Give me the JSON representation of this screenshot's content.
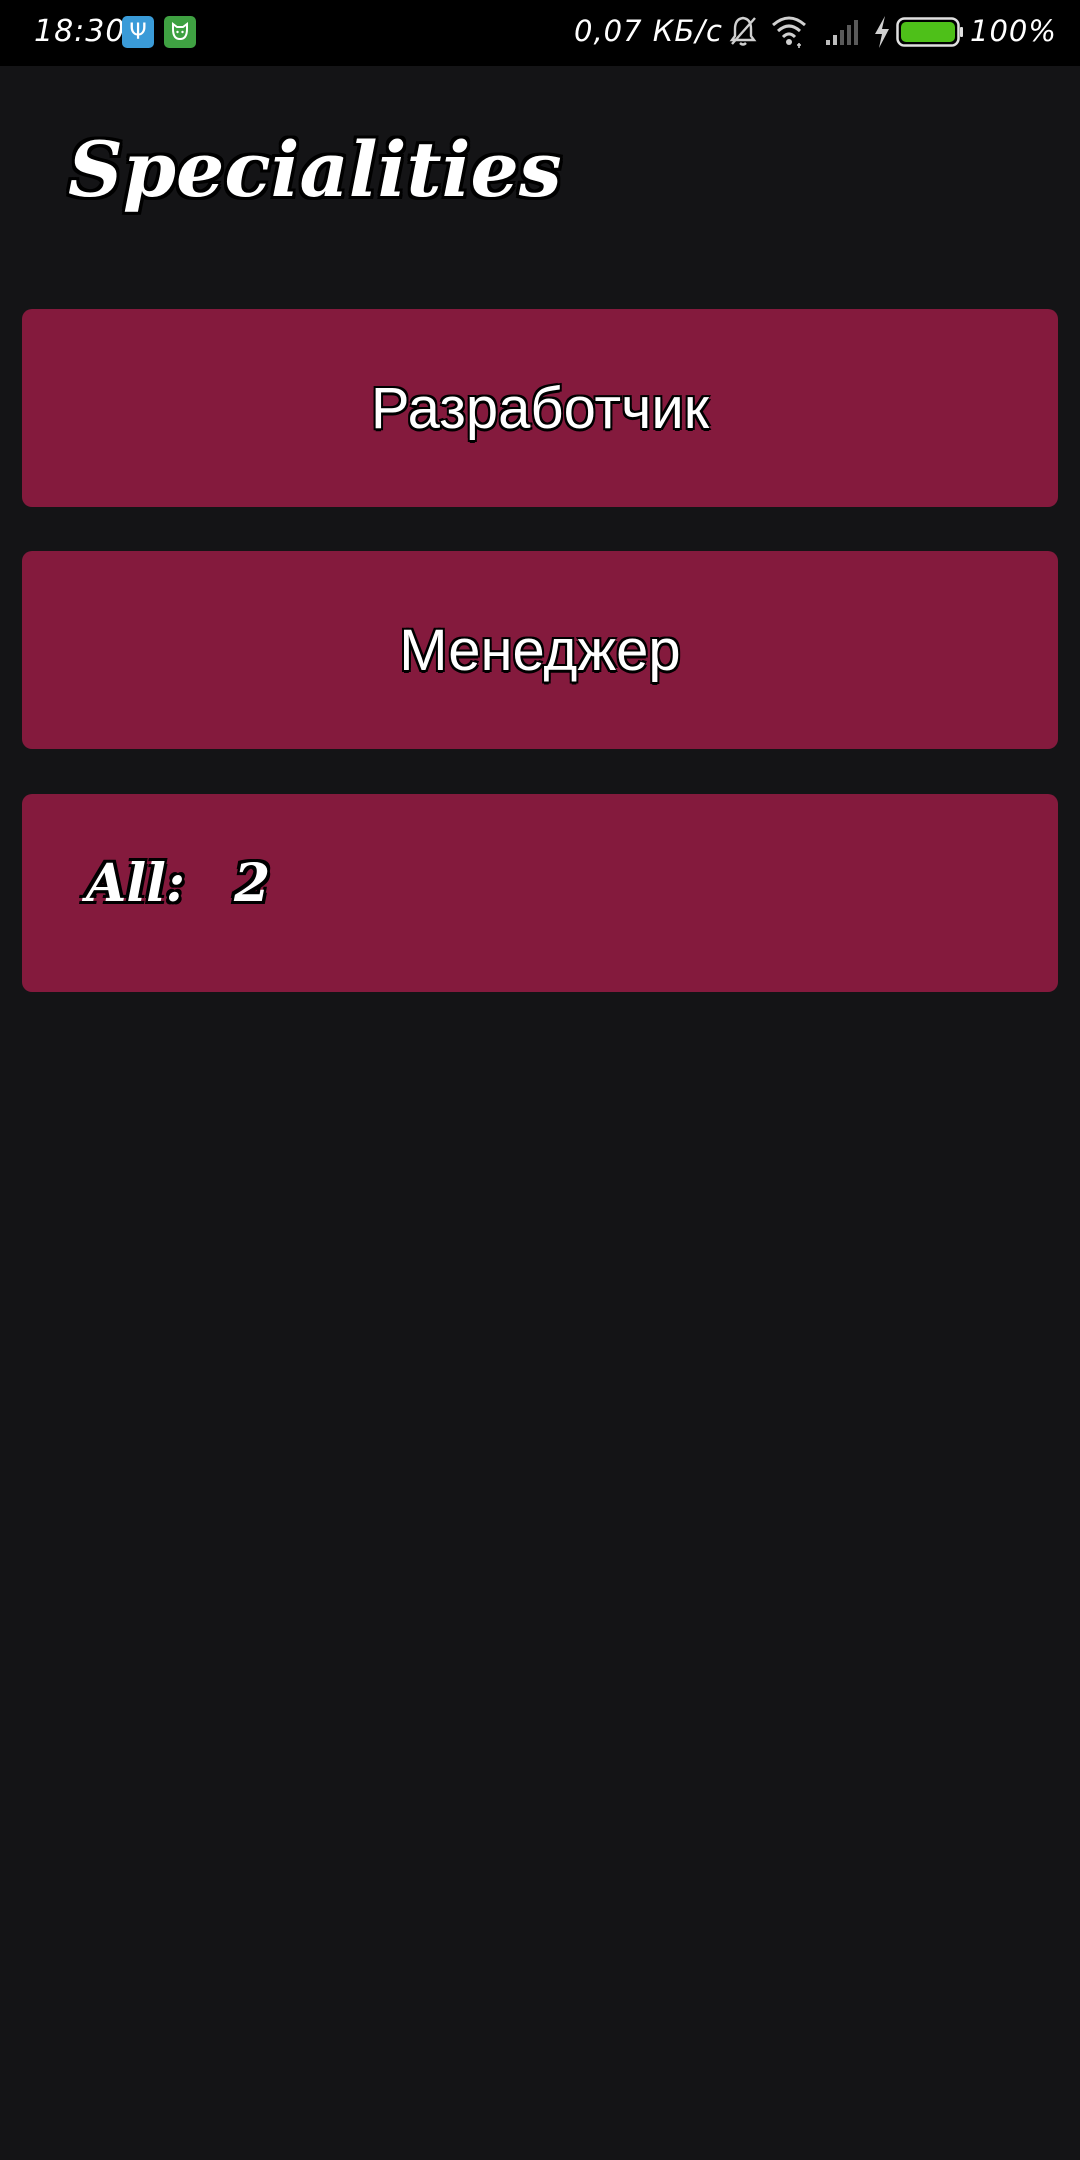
{
  "status_bar": {
    "time": "18:30",
    "network_speed": "0,07 КБ/с",
    "battery_percent": "100%",
    "battery_level": 1.0,
    "icons": [
      "usb-icon",
      "cat-app-icon",
      "bell-muted-icon",
      "wifi-icon",
      "cell-signal-icon",
      "charging-bolt-icon",
      "battery-icon"
    ]
  },
  "page": {
    "title": "Specialities"
  },
  "specialities": [
    {
      "label": "Разработчик"
    },
    {
      "label": "Менеджер"
    }
  ],
  "summary": {
    "label": "All:",
    "count": "2"
  },
  "colors": {
    "background": "#141416",
    "card": "#841a3d",
    "battery_fill": "#4ec019"
  }
}
